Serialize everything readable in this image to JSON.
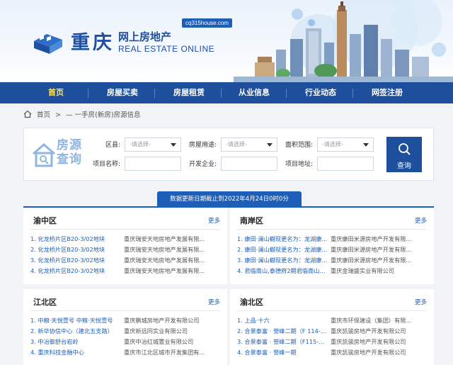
{
  "header": {
    "logo_cn": "重庆",
    "logo_sub": "网上房地产",
    "logo_en": "REAL ESTATE ONLINE",
    "domain": "cq315house.com"
  },
  "nav": [
    {
      "label": "首页",
      "active": true
    },
    {
      "label": "房屋买卖",
      "active": false
    },
    {
      "label": "房屋租赁",
      "active": false
    },
    {
      "label": "从业信息",
      "active": false
    },
    {
      "label": "行业动态",
      "active": false
    },
    {
      "label": "网签注册",
      "active": false
    }
  ],
  "breadcrumb": {
    "home": "首页",
    "sep": ">",
    "current": "一手房(新房)房源信息"
  },
  "search": {
    "logo_line1": "房源",
    "logo_line2": "查询",
    "district_label": "区县:",
    "district_value": "-请选择-",
    "usage_label": "房屋用途:",
    "usage_value": "-请选择-",
    "area_label": "面积范围:",
    "area_value": "-请选择-",
    "project_label": "项目名称:",
    "developer_label": "开发企业:",
    "address_label": "项目地址:",
    "button_label": "查询"
  },
  "update_notice": "数据更新日期截止到2022年4月24日0时0分",
  "more_label": "更多",
  "panels": [
    {
      "title": "渝中区",
      "rows": [
        {
          "name": "1. 化龙桥片区B20-3/02地块",
          "company": "重庆瑞安天地房地产发展有限..."
        },
        {
          "name": "2. 化龙桥片区B20-3/02地块",
          "company": "重庆瑞安天地房地产发展有限..."
        },
        {
          "name": "3. 化龙桥片区B20-3/02地块",
          "company": "重庆瑞安天地房地产发展有限..."
        },
        {
          "name": "4. 化龙桥片区B20-3/02地块",
          "company": "重庆瑞安天地房地产发展有限..."
        }
      ]
    },
    {
      "title": "南岸区",
      "rows": [
        {
          "name": "1. 康田·澜山樾现更名为：龙湖康...",
          "company": "重庆康田米源房地产开发有限..."
        },
        {
          "name": "2. 康田·澜山樾现更名为：龙湖康...",
          "company": "重庆康田米源房地产开发有限..."
        },
        {
          "name": "3. 康田·澜山樾现更名为：龙湖康...",
          "company": "重庆康田米源房地产开发有限..."
        },
        {
          "name": "4. 君临南山,泰德府2期君临南山2期",
          "company": "重庆金瑞盛实业有限公司"
        }
      ]
    },
    {
      "title": "江北区",
      "rows": [
        {
          "name": "1. 中粮·天悦壹号 中粮·天悦壹号",
          "company": "重庆鹏城房地产开发有限公司"
        },
        {
          "name": "2. 新华协信中心（建北五支路）",
          "company": "重庆新远同实业有限公司"
        },
        {
          "name": "3. 中冶御舒台崧岭",
          "company": "重庆中冶红城置业有限公司"
        },
        {
          "name": "4. 重庆科技金融中心",
          "company": "重庆市江北区城市开发集团有..."
        }
      ]
    },
    {
      "title": "渝北区",
      "rows": [
        {
          "name": "1. 上品·十六",
          "company": "重庆市环保建设（集团）有限..."
        },
        {
          "name": "2. 合景泰富 · 誉峰二期（F 114-1...",
          "company": "重庆凯骏房地产开发有限公司"
        },
        {
          "name": "3. 合景泰富 · 誉峰二期（F115-1...",
          "company": "重庆凯骏房地产开发有限公司"
        },
        {
          "name": "4. 合景泰富 · 誉峰一期",
          "company": "重庆凯骏房地产开发有限公司"
        }
      ]
    }
  ],
  "colors": {
    "nav_bg": "#1d4f9c",
    "accent": "#1d5fb8",
    "nav_active": "#ffe36a"
  }
}
